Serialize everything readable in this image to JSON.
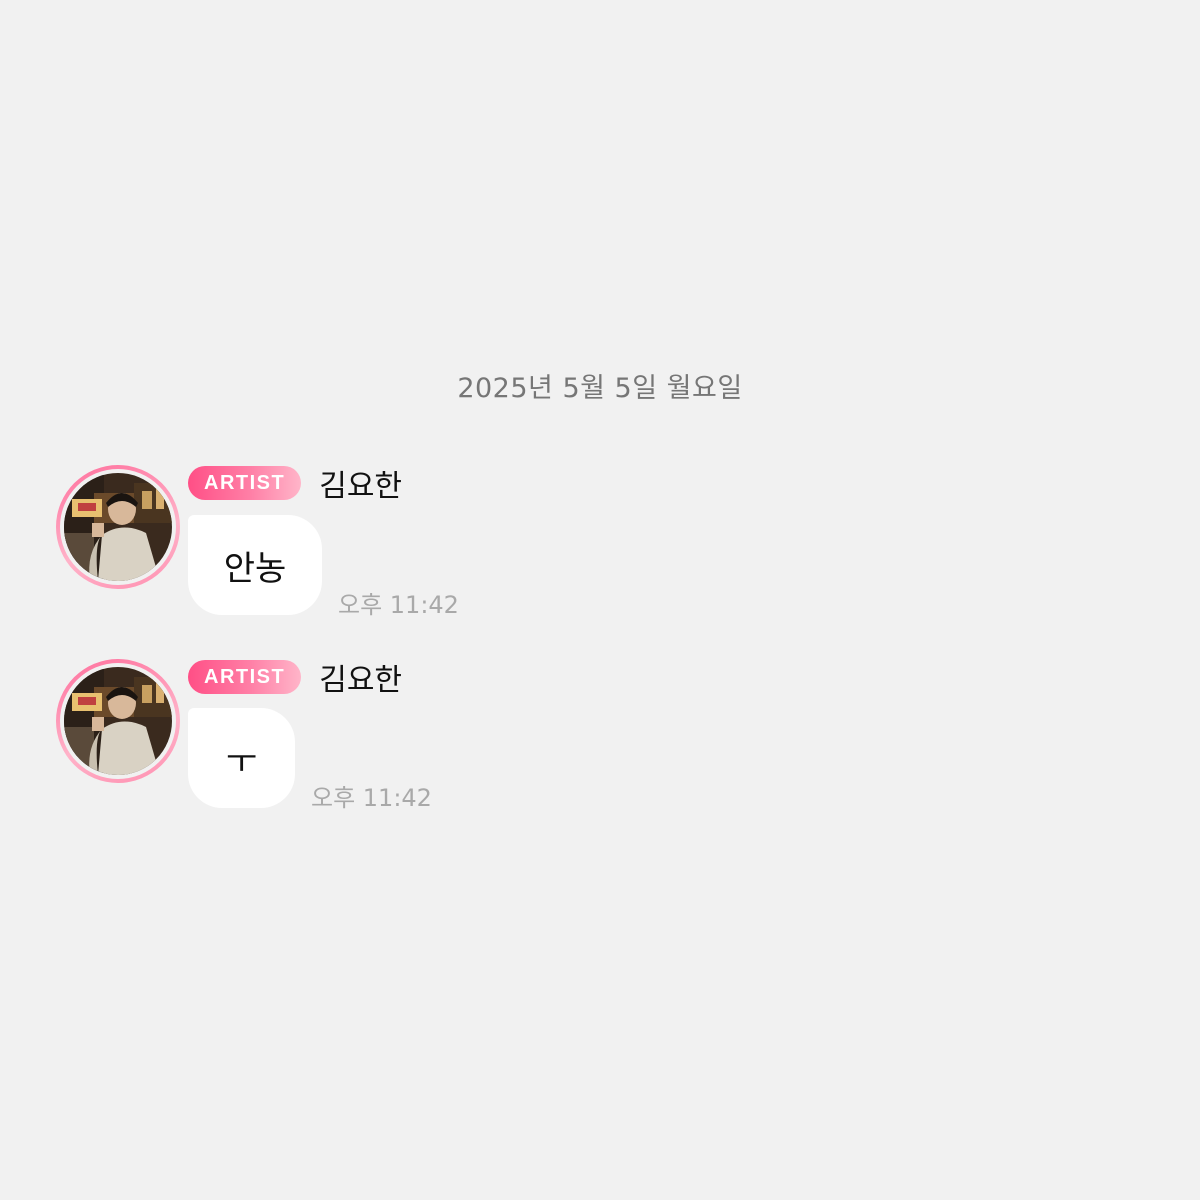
{
  "chat": {
    "date_divider": "2025년 5월 5일 월요일",
    "messages": [
      {
        "badge": "ARTIST",
        "sender": "김요한",
        "text": "안농",
        "time": "오후 11:42"
      },
      {
        "badge": "ARTIST",
        "sender": "김요한",
        "text": "ㅜ",
        "time": "오후 11:42"
      }
    ]
  },
  "colors": {
    "background": "#f1f1f1",
    "badge_gradient_start": "#ff4f86",
    "badge_gradient_end": "#ffb5c9",
    "bubble": "#ffffff",
    "timestamp": "#a9a9a9",
    "date_divider": "#767676"
  },
  "icons": {
    "avatar": "avatar-photo"
  }
}
